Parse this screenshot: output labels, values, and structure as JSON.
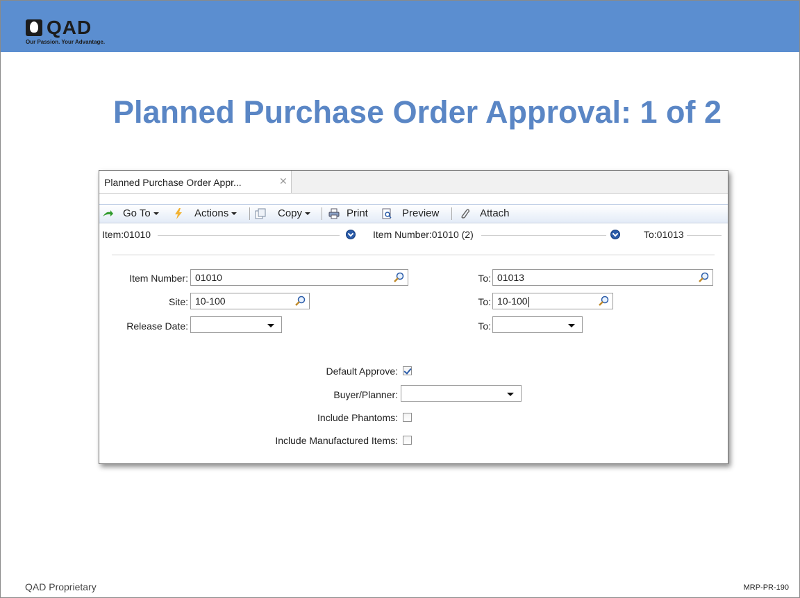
{
  "banner": {
    "logo_text": "QAD",
    "tagline": "Our Passion. Your Advantage."
  },
  "slide": {
    "title": "Planned Purchase Order Approval: 1 of 2"
  },
  "window": {
    "tab_label": "Planned Purchase Order Appr...",
    "tab_close": "✕",
    "toolbar": {
      "goto": "Go To",
      "actions": "Actions",
      "copy": "Copy",
      "print": "Print",
      "preview": "Preview",
      "attach": "Attach"
    },
    "breadcrumbs": [
      "Item:01010",
      "Item Number:01010 (2)",
      "To:01013"
    ],
    "form": {
      "item_number_label": "Item Number:",
      "item_number_value": "01010",
      "item_number_to_label": "To:",
      "item_number_to_value": "01013",
      "site_label": "Site:",
      "site_value": "10-100",
      "site_to_label": "To:",
      "site_to_value": "10-100",
      "release_date_label": "Release Date:",
      "release_date_value": "",
      "release_date_to_label": "To:",
      "release_date_to_value": "",
      "default_approve_label": "Default Approve:",
      "default_approve_checked": true,
      "buyer_planner_label": "Buyer/Planner:",
      "buyer_planner_value": "",
      "include_phantoms_label": "Include Phantoms:",
      "include_phantoms_checked": false,
      "include_manufactured_label": "Include Manufactured Items:",
      "include_manufactured_checked": false
    }
  },
  "footer": {
    "left": "QAD Proprietary",
    "right": "MRP-PR-190"
  },
  "colors": {
    "banner": "#5b8ed0",
    "title": "#5a86c5",
    "accent_blue": "#2a5ba8"
  }
}
